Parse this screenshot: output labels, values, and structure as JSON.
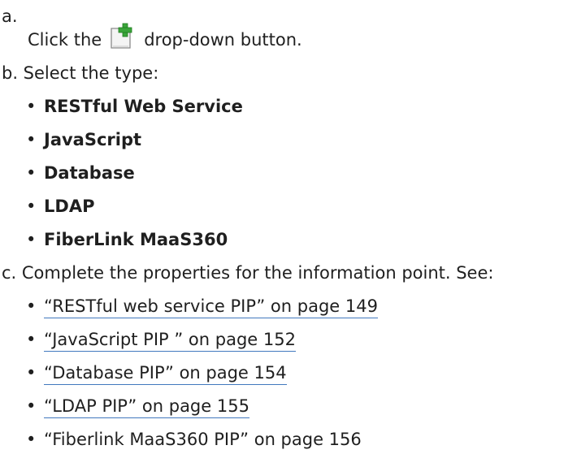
{
  "step_a": {
    "marker": "a.",
    "text_before": "Click the",
    "text_after": "drop-down button.",
    "icon": "new-document-plus-icon"
  },
  "step_b": {
    "text": "b. Select the type:",
    "types": [
      "RESTful Web Service",
      "JavaScript",
      "Database",
      "LDAP",
      "FiberLink MaaS360"
    ]
  },
  "step_c": {
    "text": "c. Complete the properties for the information point. See:",
    "links": [
      "“RESTful web service PIP” on page 149",
      "“JavaScript PIP ” on page 152",
      "“Database PIP” on page 154",
      "“LDAP PIP” on page 155",
      "“Fiberlink MaaS360 PIP” on page 156"
    ]
  },
  "colors": {
    "text": "#1f1f1f",
    "link_underline": "#4178be",
    "icon_green": "#3aa53a"
  }
}
